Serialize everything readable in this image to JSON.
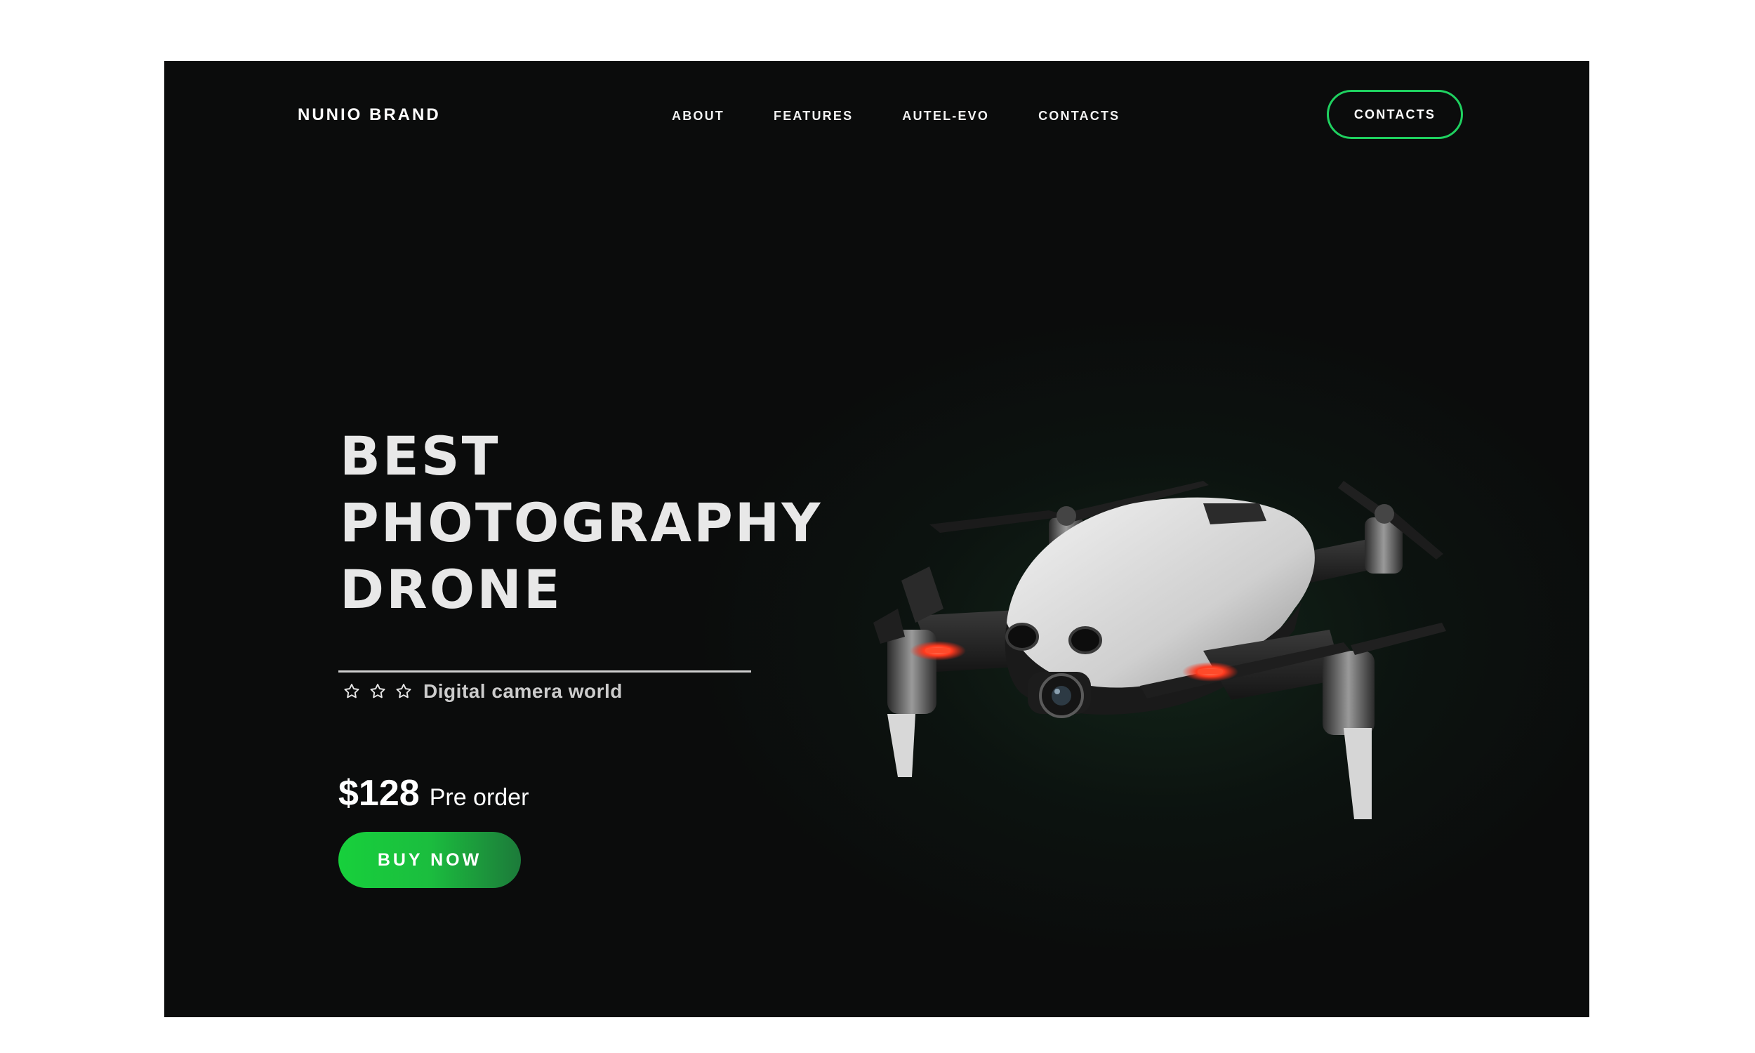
{
  "header": {
    "brand": "NUNIO BRAND",
    "nav": [
      "ABOUT",
      "FEATURES",
      "AUTEL-EVO",
      "CONTACTS"
    ],
    "cta": "CONTACTS"
  },
  "hero": {
    "title_lines": [
      "BEST",
      "PHOTOGRAPHY",
      "DRONE"
    ],
    "tagline": "Digital camera world",
    "stars": 3,
    "price": "$128",
    "price_note": "Pre order",
    "buy_label": "BUY NOW"
  },
  "colors": {
    "accent": "#1fd160",
    "background": "#0b0c0c",
    "text": "#ffffff"
  },
  "icons": [
    "star-icon",
    "drone-image"
  ]
}
